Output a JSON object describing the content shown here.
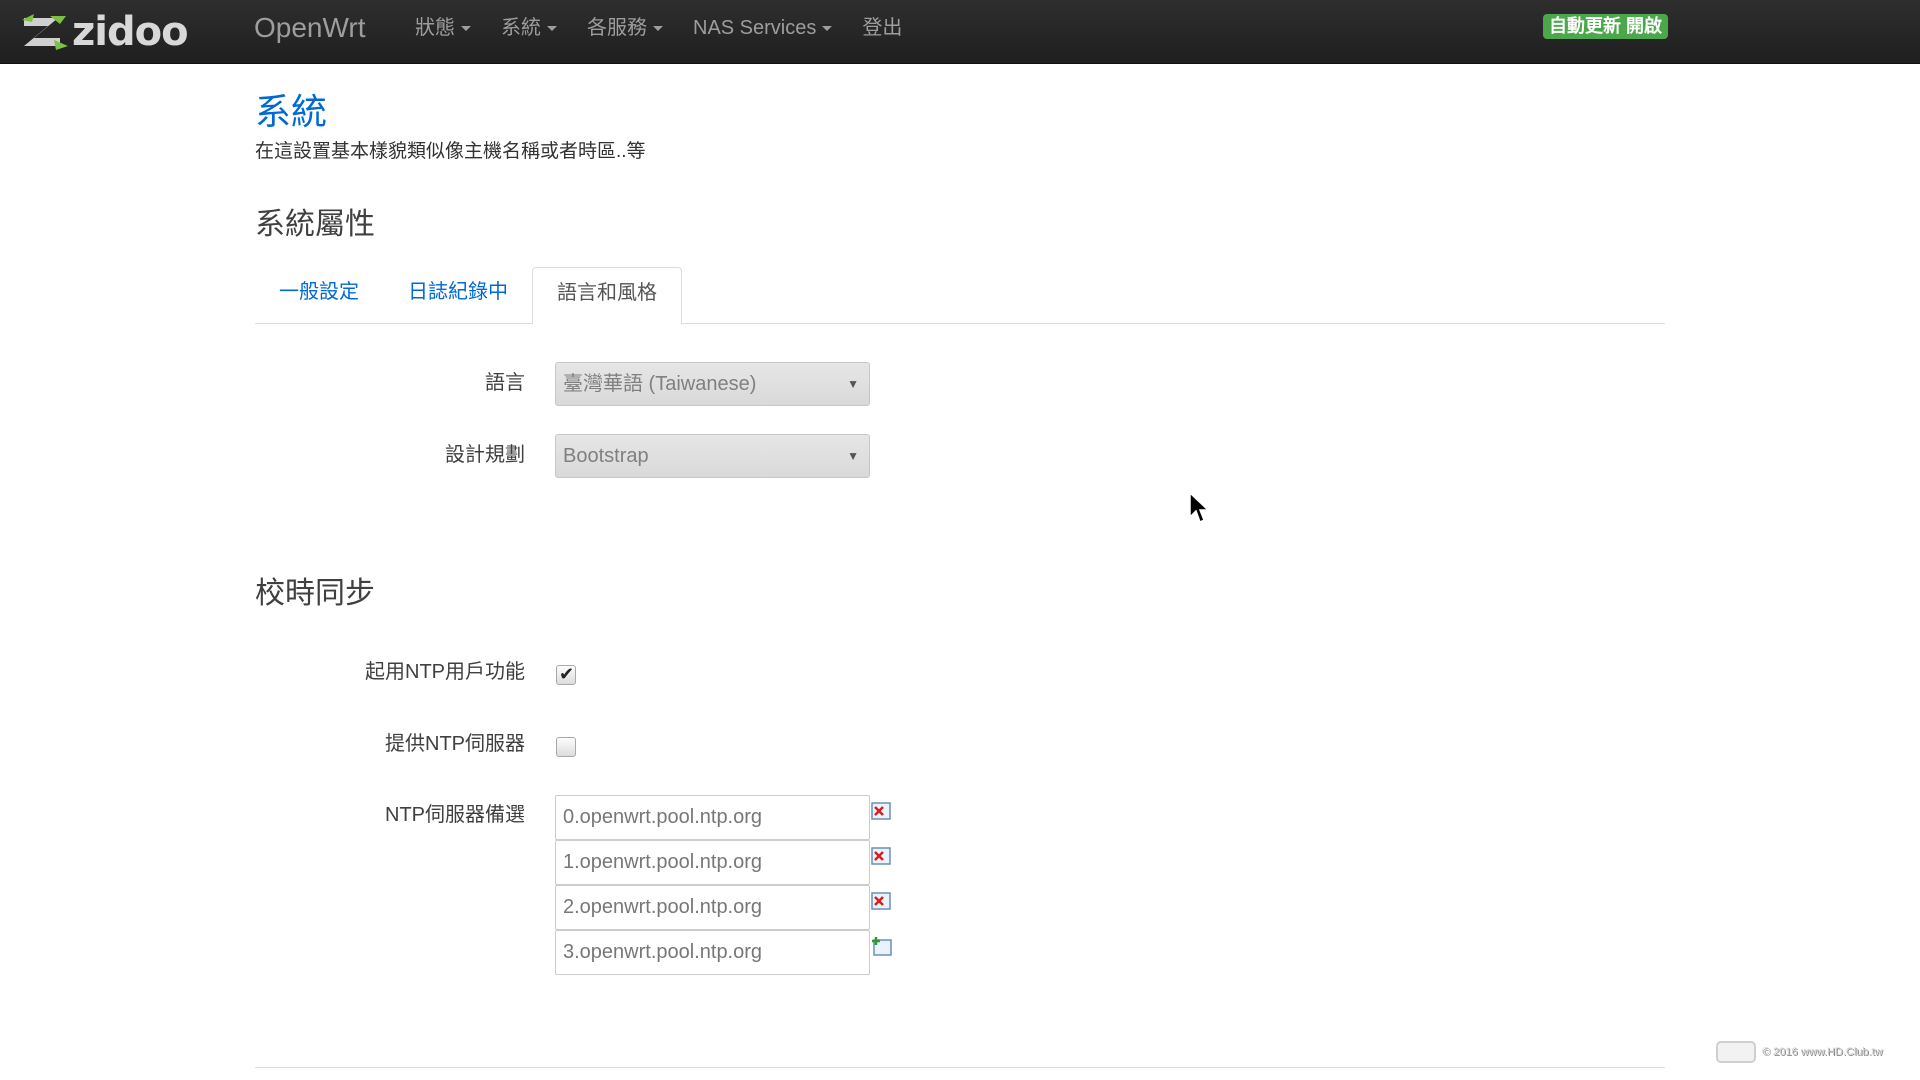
{
  "navbar": {
    "logo_text": "zidoo",
    "brand": "OpenWrt",
    "menu": [
      {
        "label": "狀態",
        "has_dropdown": true
      },
      {
        "label": "系統",
        "has_dropdown": true
      },
      {
        "label": "各服務",
        "has_dropdown": true
      },
      {
        "label": "NAS Services",
        "has_dropdown": true
      },
      {
        "label": "登出",
        "has_dropdown": false
      }
    ],
    "autorefresh": "自動更新 開啟"
  },
  "page": {
    "title": "系統",
    "description": "在這設置基本樣貌類似像主機名稱或者時區..等"
  },
  "system_properties": {
    "title": "系統屬性",
    "tabs": [
      {
        "label": "一般設定",
        "active": false
      },
      {
        "label": "日誌紀錄中",
        "active": false
      },
      {
        "label": "語言和風格",
        "active": true
      }
    ],
    "language_label": "語言",
    "language_value": "臺灣華語 (Taiwanese)",
    "design_label": "設計規劃",
    "design_value": "Bootstrap"
  },
  "time_sync": {
    "title": "校時同步",
    "enable_ntp_label": "起用NTP用戶功能",
    "enable_ntp_checked": true,
    "provide_ntp_label": "提供NTP伺服器",
    "provide_ntp_checked": false,
    "candidates_label": "NTP伺服器備選",
    "servers": [
      {
        "value": "0.openwrt.pool.ntp.org",
        "action": "remove-icon"
      },
      {
        "value": "1.openwrt.pool.ntp.org",
        "action": "remove-icon"
      },
      {
        "value": "2.openwrt.pool.ntp.org",
        "action": "remove-icon"
      },
      {
        "value": "3.openwrt.pool.ntp.org",
        "action": "add-icon"
      }
    ]
  },
  "watermark": {
    "text": "© 2016 www.HD.Club.tw"
  },
  "colors": {
    "navbar_bg": "#222222",
    "accent": "#0069d6",
    "autorefresh_bg": "#4ca64c"
  }
}
